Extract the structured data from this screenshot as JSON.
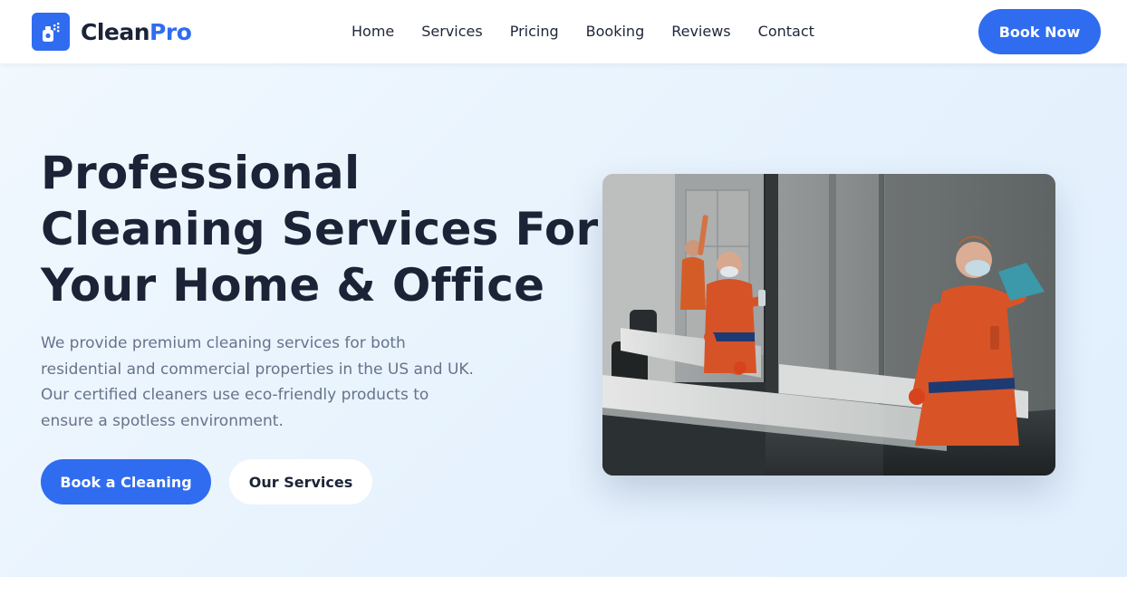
{
  "brand": {
    "name_part1": "Clean",
    "name_part2": "Pro",
    "logo_icon": "spray-bottle-icon",
    "accent_color": "#2f6cf0"
  },
  "nav": {
    "items": [
      {
        "label": "Home"
      },
      {
        "label": "Services"
      },
      {
        "label": "Pricing"
      },
      {
        "label": "Booking"
      },
      {
        "label": "Reviews"
      },
      {
        "label": "Contact"
      }
    ],
    "cta_label": "Book Now"
  },
  "hero": {
    "title_lines": [
      "Professional",
      "Cleaning Services For",
      "Your Home & Office"
    ],
    "description_lines": [
      "We provide premium cleaning services for both",
      "residential and commercial properties in the US and UK.",
      "Our certified cleaners use eco-friendly products to",
      "ensure a spotless environment."
    ],
    "primary_button": "Book a Cleaning",
    "secondary_button": "Our Services"
  },
  "colors": {
    "heading": "#1b2436",
    "body_text": "#66738a",
    "hero_background": "#e6f2fd"
  }
}
